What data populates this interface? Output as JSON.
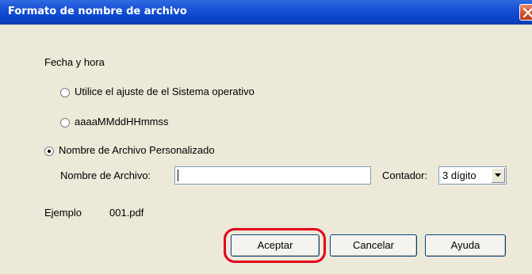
{
  "window": {
    "title": "Formato de nombre de archivo"
  },
  "fecha_hora": {
    "label": "Fecha y hora",
    "options": [
      {
        "label": "Utilice el ajuste de el Sistema operativo",
        "selected": false
      },
      {
        "label": "aaaaMMddHHmmss",
        "selected": false
      }
    ]
  },
  "custom": {
    "label": "Nombre de Archivo Personalizado",
    "selected": true,
    "filename_label": "Nombre de Archivo:",
    "filename_value": "",
    "counter_label": "Contador:",
    "counter_value": "3 dígito"
  },
  "example": {
    "label": "Ejemplo",
    "value": "001.pdf"
  },
  "buttons": {
    "accept": "Aceptar",
    "cancel": "Cancelar",
    "help": "Ayuda"
  },
  "colors": {
    "highlight": "#e3001b",
    "titlebar": "#0a46cf"
  },
  "icons": {
    "close": "close-icon",
    "dropdown": "chevron-down-icon"
  }
}
